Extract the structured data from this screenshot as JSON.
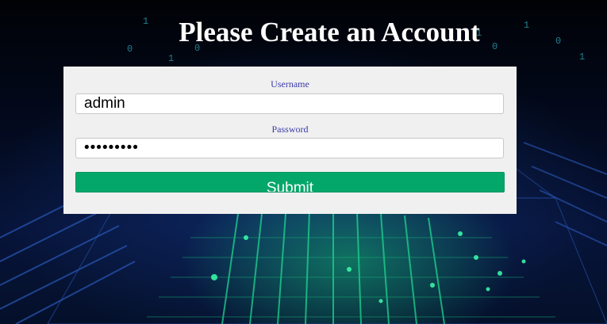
{
  "page": {
    "title": "Please Create an Account"
  },
  "form": {
    "username_label": "Username",
    "username_value": "admin",
    "password_label": "Password",
    "password_value": "123456789",
    "submit_label": "Submit"
  },
  "colors": {
    "panel_background": "#f0f0f0",
    "label_text": "#3a3aa8",
    "submit_button": "#04a76a",
    "title_text": "#ffffff"
  }
}
